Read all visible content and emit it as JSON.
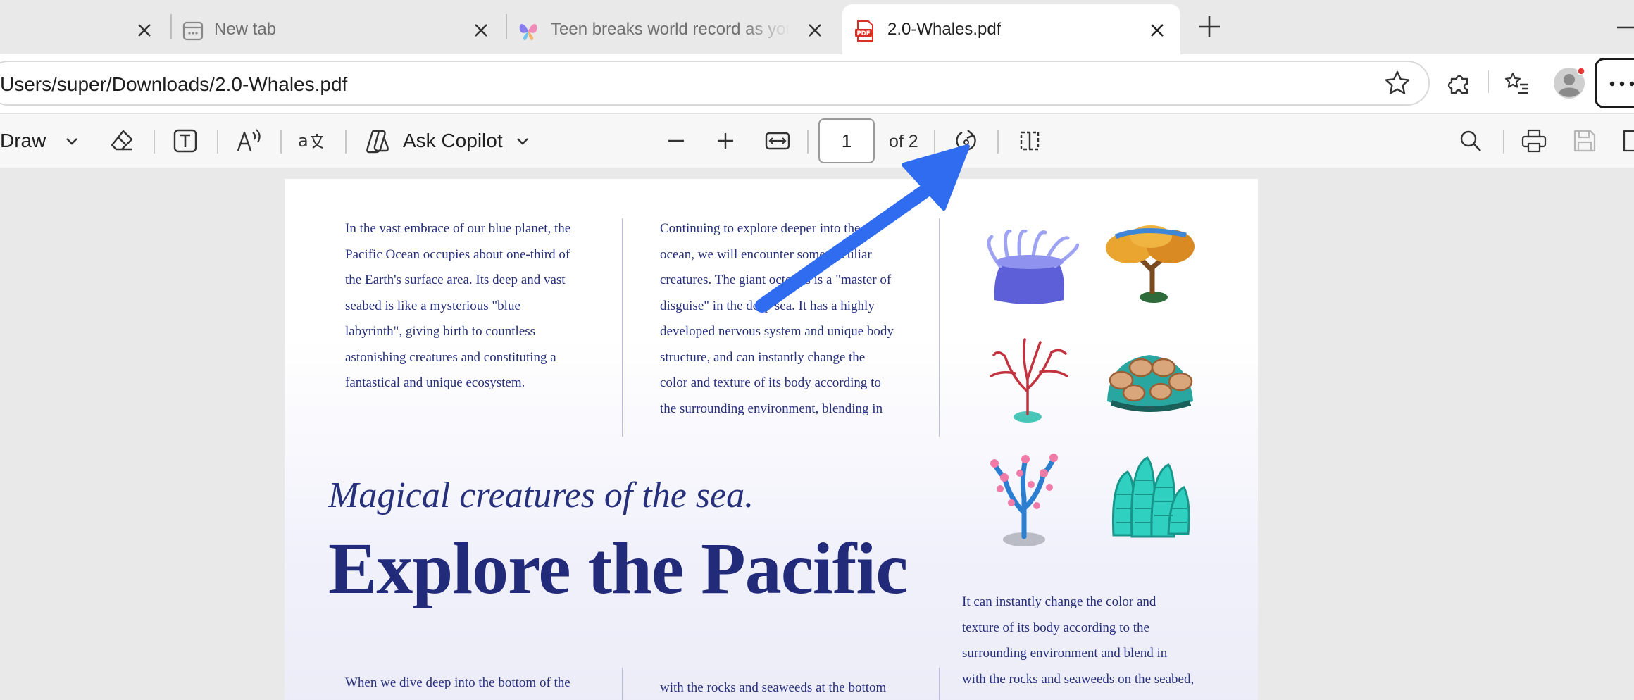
{
  "tabs": [
    {
      "title": "",
      "active": false
    },
    {
      "title": "New tab",
      "active": false
    },
    {
      "title": "Teen breaks world record as young",
      "active": false
    },
    {
      "title": "2.0-Whales.pdf",
      "active": true
    }
  ],
  "pdf_favicon_label": "PDF",
  "address": {
    "url": "Users/super/Downloads/2.0-Whales.pdf"
  },
  "pdf_toolbar": {
    "draw_label": "Draw",
    "copilot_label": "Ask Copilot",
    "page_current": "1",
    "page_total": "of 2"
  },
  "document": {
    "col1_lines": [
      "In the vast embrace of our blue planet, the",
      "Pacific Ocean occupies about one-third of",
      "the Earth's surface area. Its deep and vast",
      "seabed is like a mysterious \"blue",
      "labyrinth\", giving birth to countless",
      "astonishing creatures and constituting a",
      "fantastical and unique ecosystem."
    ],
    "col2_lines": [
      "Continuing to explore deeper into the",
      "ocean, we will encounter some peculiar",
      "creatures. The giant octopus is a \"master of",
      "disguise\" in the deep sea. It has a highly",
      "developed nervous system and unique body",
      "structure, and can instantly change the",
      "color and texture of its body according to",
      "the surrounding environment, blending in"
    ],
    "subtitle": "Magical creatures of the sea.",
    "headline": "Explore the Pacific",
    "col3_lines": [
      "It can instantly change the color and",
      "texture of its body according to the",
      "surrounding environment and blend in",
      "with the rocks and seaweeds on the seabed,"
    ],
    "bottom_col1_lines": [
      "When we dive deep into the bottom of the"
    ],
    "bottom_col2_lines": [
      "with the rocks and seaweeds at the bottom"
    ]
  },
  "colors": {
    "text_navy": "#27307a",
    "arrow_blue": "#2f6cf0",
    "pdf_red": "#d93025"
  }
}
